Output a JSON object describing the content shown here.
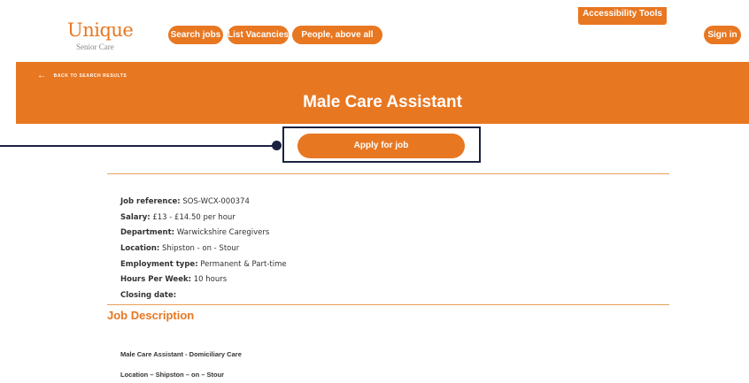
{
  "brand": {
    "name": "Unique",
    "tagline": "Senior Care",
    "color": "#e87722"
  },
  "nav": {
    "items": [
      "Search jobs",
      "List Vacancies",
      "People, above all else"
    ],
    "accessibility": "Accessibility Tools",
    "sign_in": "Sign in"
  },
  "banner": {
    "back": "BACK TO SEARCH RESULTS",
    "title": "Male Care Assistant"
  },
  "apply": {
    "label": "Apply for job"
  },
  "details": [
    {
      "label": "Job reference:",
      "value": "SOS-WCX-000374"
    },
    {
      "label": "Salary:",
      "value": "£13 - £14.50 per hour"
    },
    {
      "label": "Department:",
      "value": "Warwickshire Caregivers"
    },
    {
      "label": "Location:",
      "value": "Shipston - on - Stour"
    },
    {
      "label": "Employment type:",
      "value": "Permanent & Part-time"
    },
    {
      "label": "Hours Per Week:",
      "value": "10 hours"
    },
    {
      "label": "Closing date:",
      "value": ""
    }
  ],
  "description": {
    "heading": "Job Description",
    "lines": [
      "Male Care Assistant - Domiciliary Care",
      "Location – Shipston – on – Stour"
    ]
  }
}
